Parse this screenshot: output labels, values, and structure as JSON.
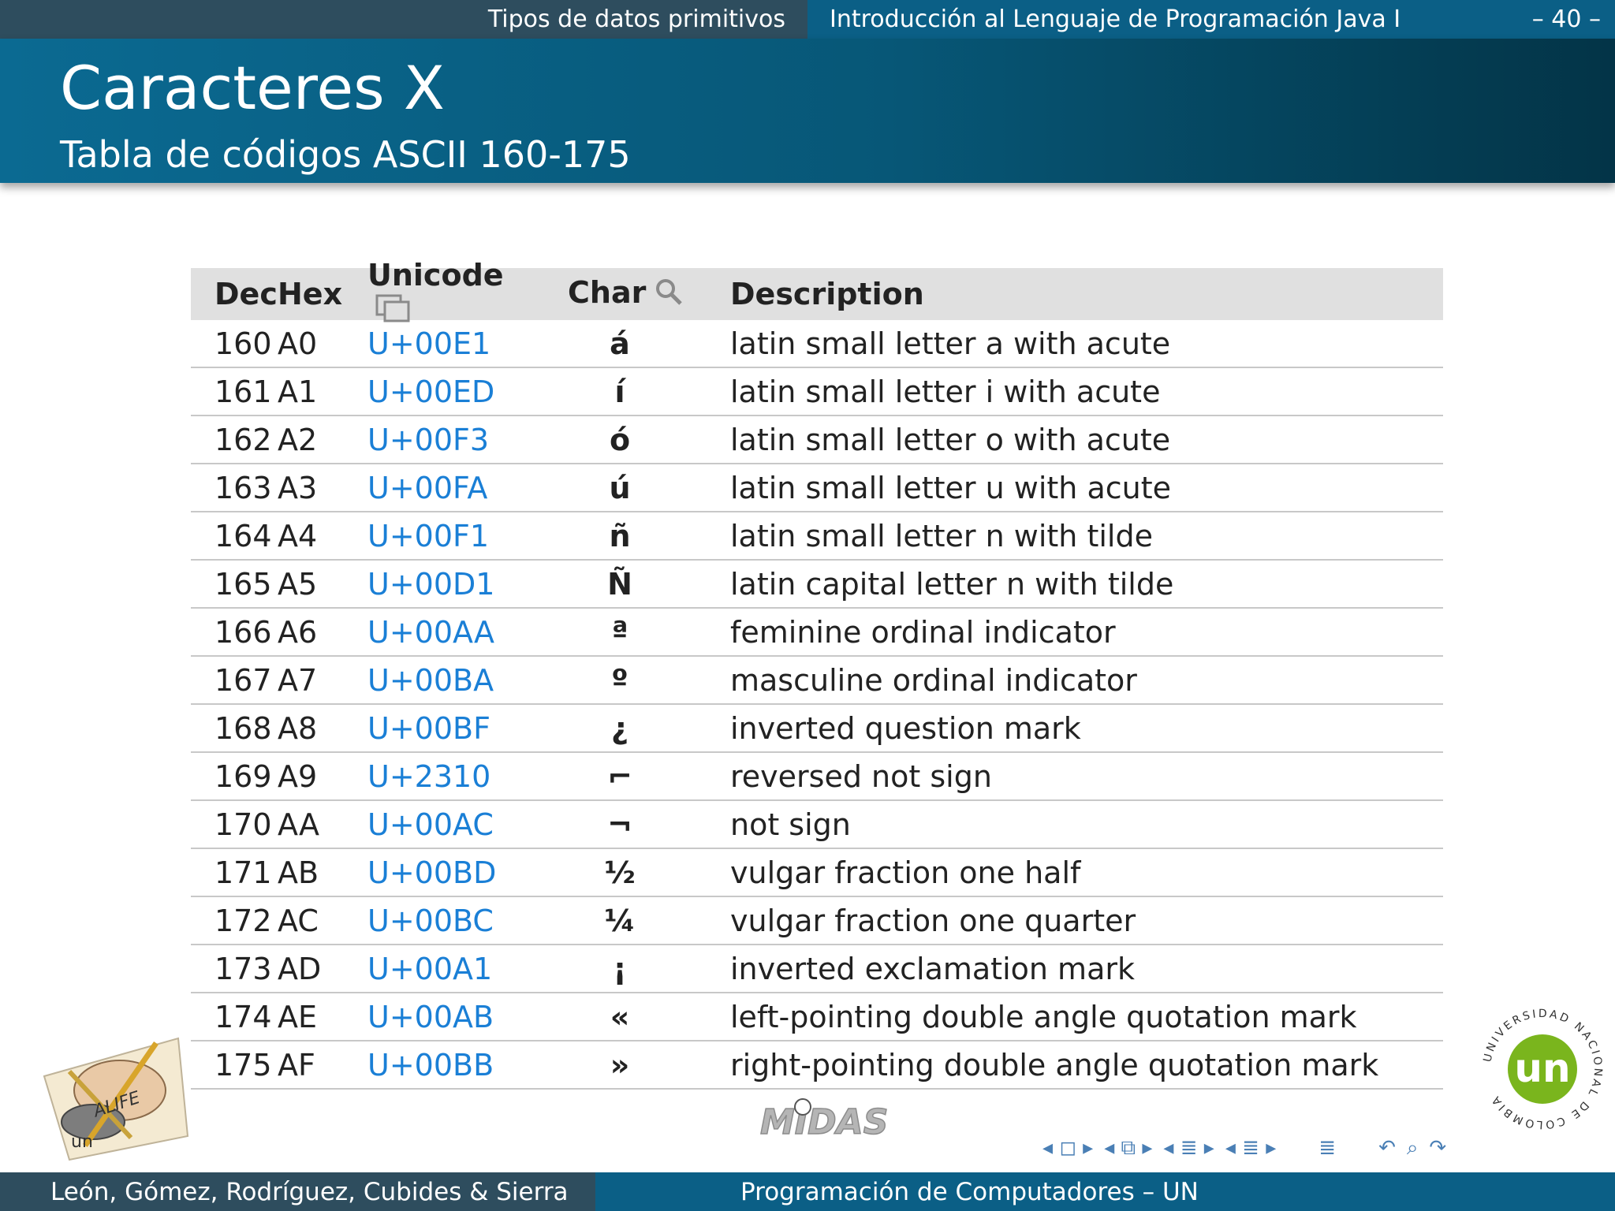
{
  "header": {
    "section": "Tipos de datos primitivos",
    "document": "Introducción al Lenguaje de Programación Java I",
    "page": "– 40 –"
  },
  "title": "Caracteres X",
  "subtitle": "Tabla de códigos ASCII 160-175",
  "table": {
    "headers": {
      "dec": "Dec",
      "hex": "Hex",
      "unicode": "Unicode",
      "char": "Char",
      "description": "Description"
    },
    "rows": [
      {
        "dec": "160",
        "hex": "A0",
        "unicode": "U+00E1",
        "char": "á",
        "description": "latin small letter a with acute"
      },
      {
        "dec": "161",
        "hex": "A1",
        "unicode": "U+00ED",
        "char": "í",
        "description": "latin small letter i with acute"
      },
      {
        "dec": "162",
        "hex": "A2",
        "unicode": "U+00F3",
        "char": "ó",
        "description": "latin small letter o with acute"
      },
      {
        "dec": "163",
        "hex": "A3",
        "unicode": "U+00FA",
        "char": "ú",
        "description": "latin small letter u with acute"
      },
      {
        "dec": "164",
        "hex": "A4",
        "unicode": "U+00F1",
        "char": "ñ",
        "description": "latin small letter n with tilde"
      },
      {
        "dec": "165",
        "hex": "A5",
        "unicode": "U+00D1",
        "char": "Ñ",
        "description": "latin capital letter n with tilde"
      },
      {
        "dec": "166",
        "hex": "A6",
        "unicode": "U+00AA",
        "char": "ª",
        "description": "feminine ordinal indicator"
      },
      {
        "dec": "167",
        "hex": "A7",
        "unicode": "U+00BA",
        "char": "º",
        "description": "masculine ordinal indicator"
      },
      {
        "dec": "168",
        "hex": "A8",
        "unicode": "U+00BF",
        "char": "¿",
        "description": "inverted question mark"
      },
      {
        "dec": "169",
        "hex": "A9",
        "unicode": "U+2310",
        "char": "⌐",
        "description": "reversed not sign"
      },
      {
        "dec": "170",
        "hex": "AA",
        "unicode": "U+00AC",
        "char": "¬",
        "description": "not sign"
      },
      {
        "dec": "171",
        "hex": "AB",
        "unicode": "U+00BD",
        "char": "½",
        "description": "vulgar fraction one half"
      },
      {
        "dec": "172",
        "hex": "AC",
        "unicode": "U+00BC",
        "char": "¼",
        "description": "vulgar fraction one quarter"
      },
      {
        "dec": "173",
        "hex": "AD",
        "unicode": "U+00A1",
        "char": "¡",
        "description": "inverted exclamation mark"
      },
      {
        "dec": "174",
        "hex": "AE",
        "unicode": "U+00AB",
        "char": "«",
        "description": "left-pointing double angle quotation mark"
      },
      {
        "dec": "175",
        "hex": "AF",
        "unicode": "U+00BB",
        "char": "»",
        "description": "right-pointing double angle quotation mark"
      }
    ]
  },
  "footer": {
    "authors": "León, Gómez, Rodríguez, Cubides & Sierra",
    "course": "Programación de Computadores – UN"
  },
  "logos": {
    "alife": "ALIFE",
    "alife_sub": "un",
    "midas": "MIDAS",
    "un_seal_ring": "UNIVERSIDAD NACIONAL DE COLOMBIA",
    "un_seal_center": "un"
  },
  "icons": {
    "header_unicode": "copy-icon",
    "header_char": "magnifier-icon",
    "nav": [
      "nav-frame-icon",
      "nav-subsection-icon",
      "nav-section-icon",
      "nav-subsection-list-icon",
      "nav-menu-icon",
      "nav-back-icon",
      "nav-search-icon",
      "nav-forward-icon"
    ]
  },
  "colors": {
    "header_dark": "#2e4d5e",
    "header_blue": "#0b5f86",
    "link_blue": "#1a7fd6",
    "table_header_bg": "#e0e0e0",
    "un_green": "#7ab51d"
  }
}
